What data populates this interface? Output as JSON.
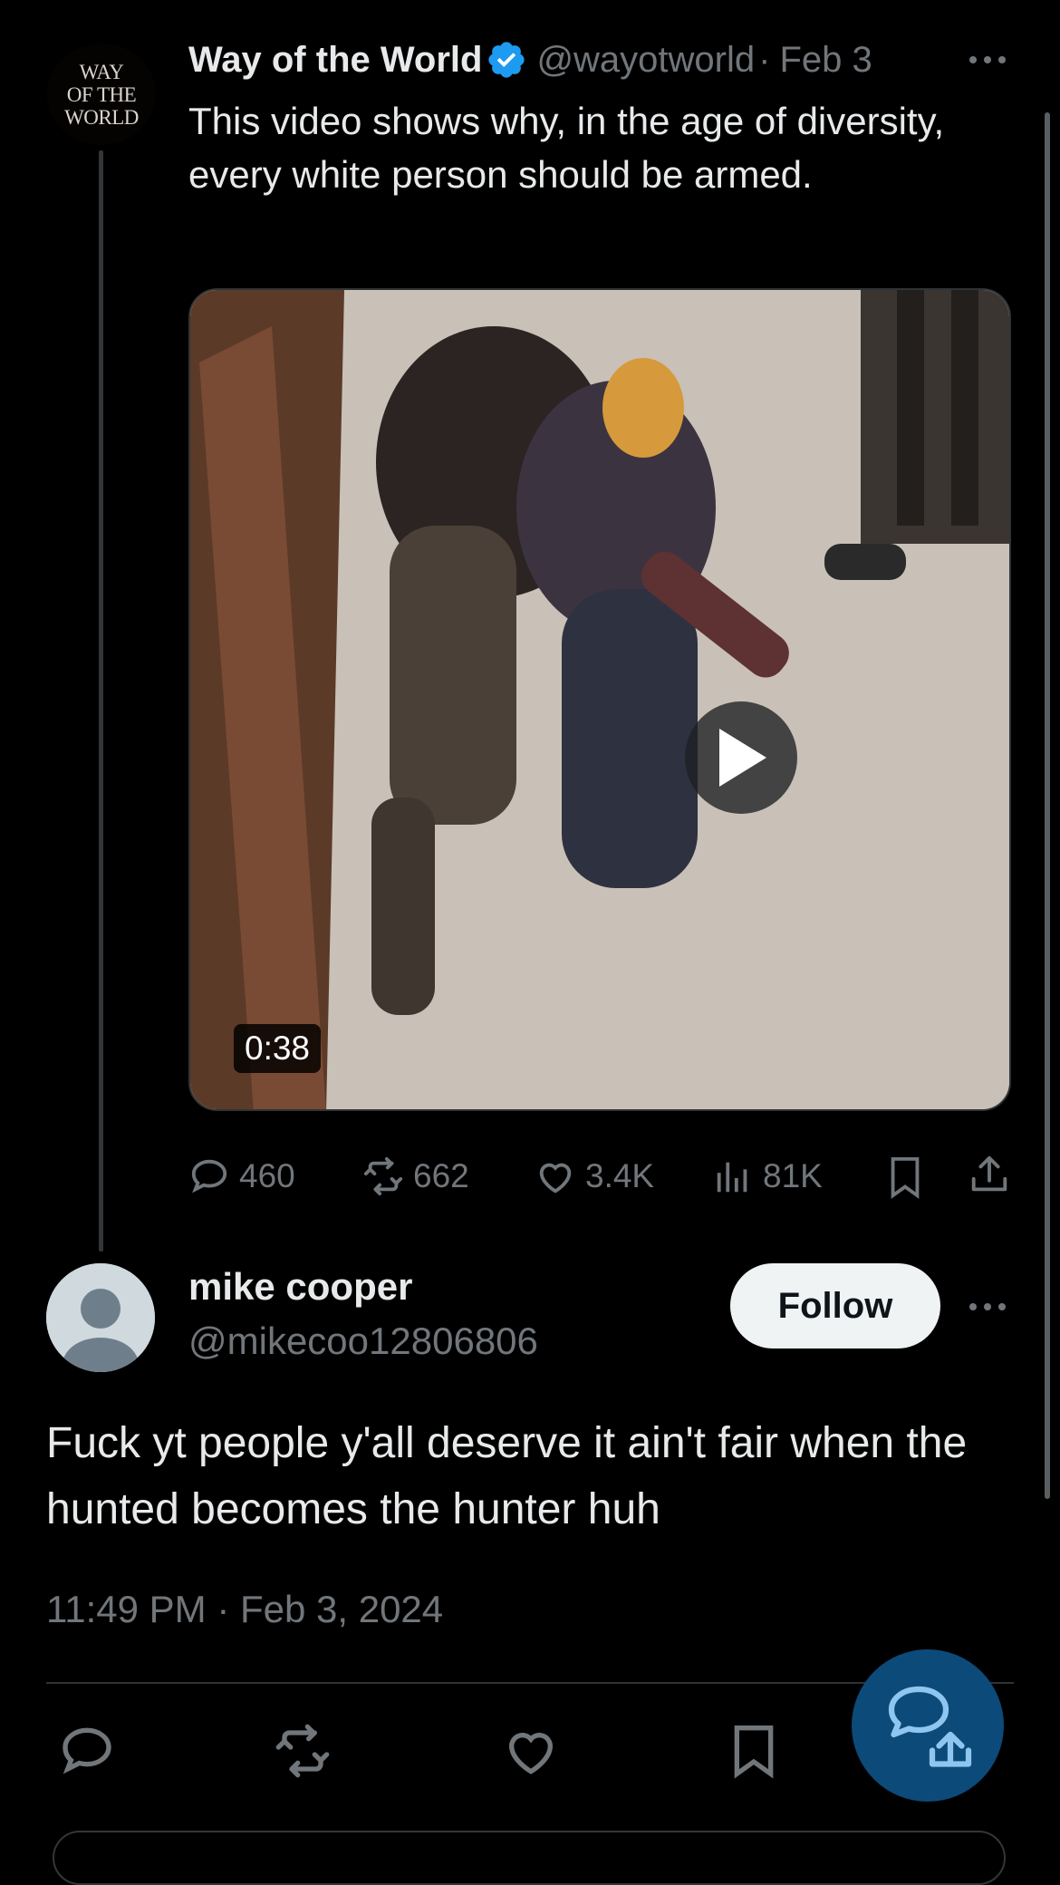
{
  "parent_tweet": {
    "avatar_text": [
      "WAY",
      "OF THE",
      "WORLD"
    ],
    "display_name": "Way of the World",
    "handle": "@wayotworld",
    "separator": "·",
    "date": "Feb 3",
    "text": "This video shows why, in the age of diversity, every white person should be armed.",
    "video": {
      "duration": "0:38"
    },
    "stats": {
      "replies": "460",
      "reposts": "662",
      "likes": "3.4K",
      "views": "81K"
    }
  },
  "reply_tweet": {
    "display_name": "mike cooper",
    "handle": "@mikecoo12806806",
    "follow_label": "Follow",
    "text": "Fuck yt people y'all deserve it ain't fair when the hunted becomes the hunter huh",
    "timestamp": "11:49 PM · Feb 3, 2024"
  },
  "colors": {
    "background": "#000000",
    "text_primary": "#e7e9ea",
    "text_secondary": "#71767b",
    "verified_blue": "#1d9bf0",
    "fab_bg": "#0c4a7a"
  },
  "icons": [
    "more-icon",
    "verified-badge-icon",
    "play-icon",
    "reply-icon",
    "repost-icon",
    "like-icon",
    "views-icon",
    "bookmark-icon",
    "share-icon",
    "compose-reply-icon"
  ]
}
